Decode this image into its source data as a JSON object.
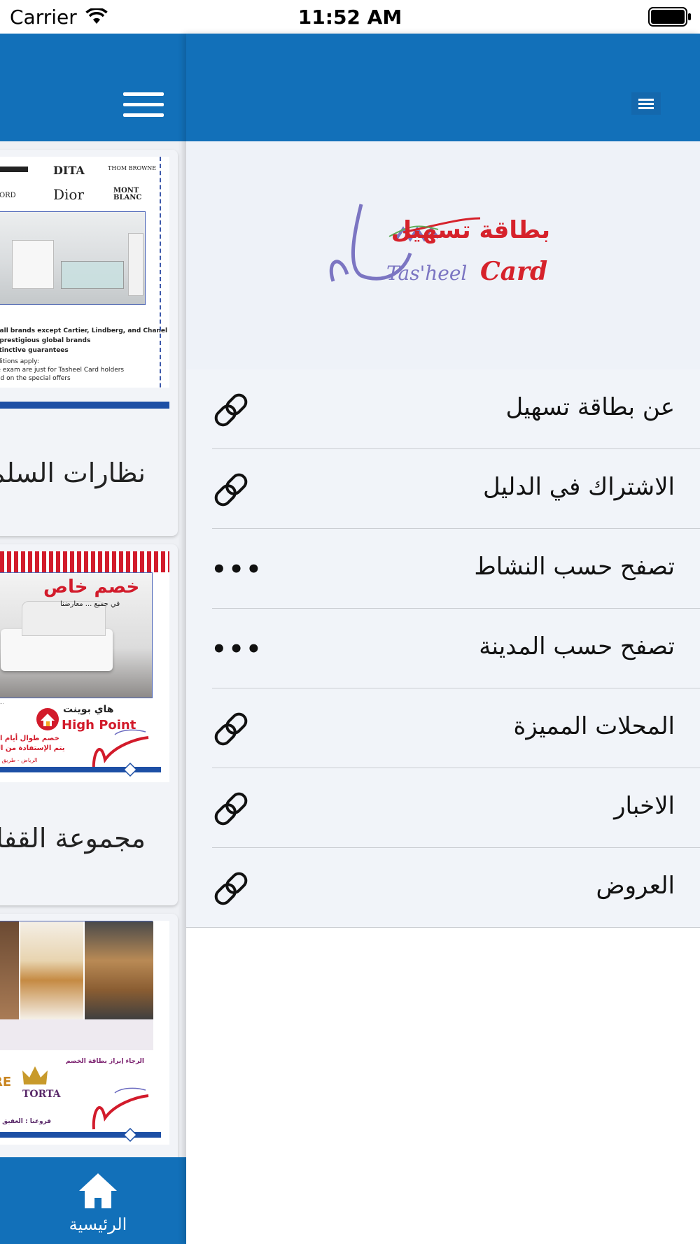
{
  "status_bar": {
    "carrier": "Carrier",
    "time": "11:52 AM"
  },
  "main": {
    "cards": [
      {
        "title": "نظارات السلم",
        "brands": [
          "DITA",
          "Dior",
          "MONT BLANC",
          "THOM BROWNE",
          "FORD"
        ],
        "ad_lines": [
          "n all brands except Cartier, Lindberg, and Chanel *",
          "0 prestigious global brands",
          "istinctive guarantees",
          "nditions apply:",
          "ye exam are just for Tasheel Card holders",
          "lied on the special offers"
        ]
      },
      {
        "title": "مجموعة القفار",
        "promo_heading": "خصم خاص",
        "promo_sub": "في جميع ... معارضنا",
        "store_name": "High Point",
        "store_arabic": "هاي بوينت",
        "ad_lines": [
          "خصم طوال أيام ا",
          "يتم الإستفادة من الخ",
          "الرياض - طريق الم"
        ]
      },
      {
        "title": "",
        "brand": "TORTA",
        "ad_lines": [
          "الرجاء إبراز بطاقة الخصم",
          "فروعنا : العقيق - ا"
        ]
      }
    ],
    "bottom_tab": {
      "label": "الرئيسية",
      "icon": "home-icon"
    }
  },
  "drawer": {
    "logo": {
      "arabic": "بطاقة تسهيل",
      "latin": "Tas'heel",
      "card": "Card"
    },
    "items": [
      {
        "label": "عن بطاقة تسهيل",
        "icon": "link-icon"
      },
      {
        "label": "الاشتراك في الدليل",
        "icon": "link-icon"
      },
      {
        "label": "تصفح حسب النشاط",
        "icon": "more-icon",
        "dots": "•••"
      },
      {
        "label": "تصفح حسب المدينة",
        "icon": "more-icon",
        "dots": "•••"
      },
      {
        "label": "المحلات المميزة",
        "icon": "link-icon"
      },
      {
        "label": "الاخبار",
        "icon": "link-icon"
      },
      {
        "label": "العروض",
        "icon": "link-icon"
      }
    ]
  },
  "colors": {
    "primary": "#1270b9",
    "background": "#f1f4f9",
    "logo_red": "#d6222b",
    "logo_purple": "#7b75c2"
  }
}
